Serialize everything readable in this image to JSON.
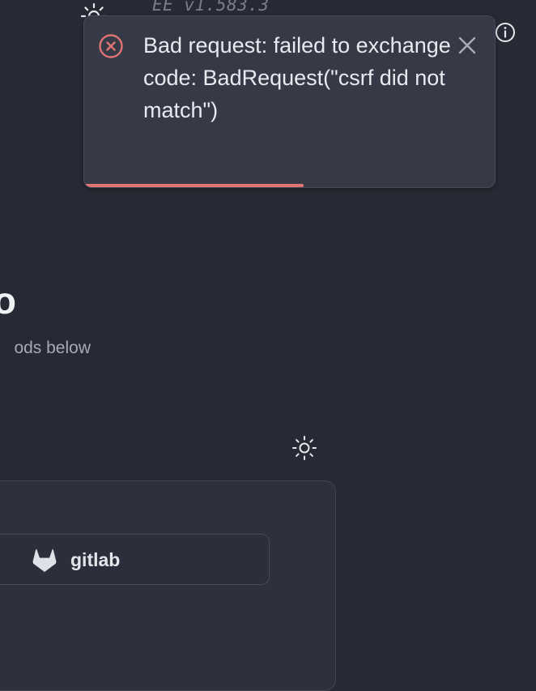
{
  "header": {
    "version": "EE v1.583.3",
    "theme_icon": "sun-icon",
    "info_icon": "info-icon"
  },
  "toast": {
    "message": "Bad request: failed to exchange code: BadRequest(\"csrf did not match\")",
    "error_icon": "error-circle-x-icon",
    "close_icon": "close-icon",
    "progress": 0.53,
    "accent_color": "#e07474"
  },
  "login": {
    "title": "o",
    "subtitle": "ods below",
    "theme_toggle_icon": "sun-icon",
    "providers": [
      {
        "label": "gitlab",
        "icon": "gitlab-icon"
      }
    ]
  }
}
